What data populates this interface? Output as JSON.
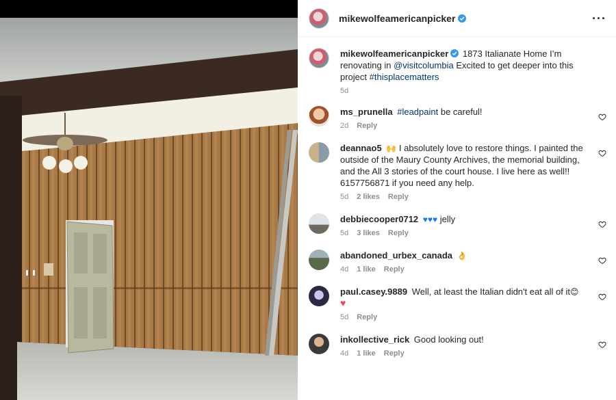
{
  "post": {
    "username": "mikewolfeamericanpicker",
    "caption_prefix": "1873 Italianate Home I’m renovating in",
    "caption_mention": "@visitcolumbia",
    "caption_middle": "Excited to get deeper into this project",
    "caption_hashtag": "#thisplacematters",
    "caption_time": "5d"
  },
  "icons": {
    "more": "more-options-icon",
    "verified": "verified-badge-icon",
    "like": "heart-outline-icon",
    "emoji_hugging": "hugging-face-emoji",
    "emoji_hearts": "blue-heart-emoji",
    "emoji_ok": "ok-hand-emoji",
    "emoji_smile": "smiling-face-emoji",
    "emoji_red_heart": "red-heart-emoji"
  },
  "colors": {
    "link": "#00376b",
    "meta": "#8e8e8e",
    "verified": "#3897f0",
    "heart_red": "#ed4956",
    "heart_blue": "#1877f2"
  },
  "comments": [
    {
      "user": "ms_prunella",
      "hashtag": "#leadpaint",
      "text": "be careful!",
      "time": "2d",
      "likes": "",
      "reply": "Reply"
    },
    {
      "user": "deannao5",
      "text": "I absolutely love to restore things. I painted the outside of the Maury County Archives, the memorial building, and the All 3 stories of the court house. I live here as well!! 6157756871 if you need any help.",
      "time": "5d",
      "likes": "2 likes",
      "reply": "Reply"
    },
    {
      "user": "debbiecooper0712",
      "text": "jelly",
      "time": "5d",
      "likes": "3 likes",
      "reply": "Reply"
    },
    {
      "user": "abandoned_urbex_canada",
      "text": "",
      "time": "4d",
      "likes": "1 like",
      "reply": "Reply"
    },
    {
      "user": "paul.casey.9889",
      "text": "Well, at least the Italian didn't eat all of it",
      "time": "5d",
      "likes": "",
      "reply": "Reply"
    },
    {
      "user": "inkollective_rick",
      "text": "Good looking out!",
      "time": "4d",
      "likes": "1 like",
      "reply": "Reply"
    }
  ]
}
